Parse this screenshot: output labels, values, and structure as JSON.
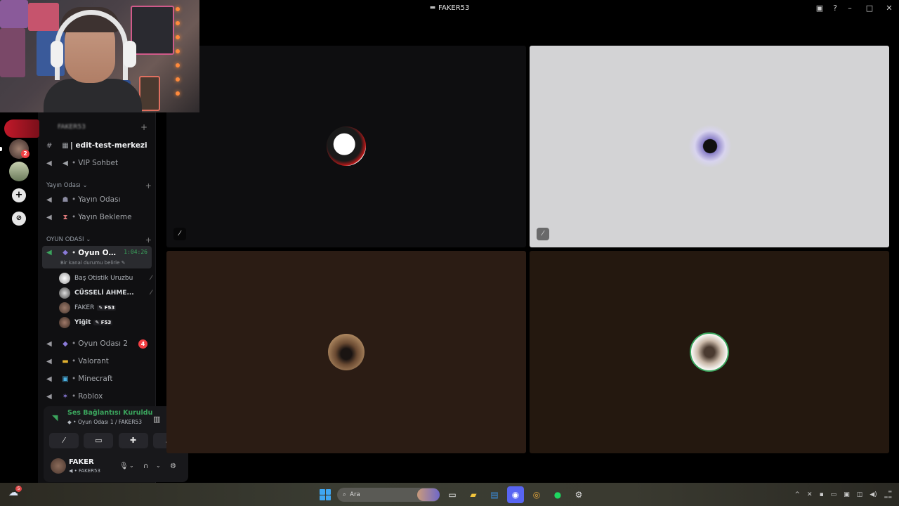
{
  "window": {
    "title": "FAKER53",
    "title_icon": "gamepad-icon",
    "controls": [
      "minimize",
      "maximize",
      "close"
    ]
  },
  "server": {
    "name": "FAKER53",
    "channels_top": [
      {
        "name": "| edit-test-merkezi",
        "type": "text",
        "unread": true
      },
      {
        "name": "VIP Sohbet",
        "type": "voice"
      }
    ],
    "categories": [
      {
        "name": "Yayın Odası",
        "channels": [
          {
            "name": "Yayın Odası",
            "type": "voice"
          },
          {
            "name": "Yayın Bekleme",
            "type": "voice"
          }
        ]
      },
      {
        "name": "OYUN ODASI",
        "channels": [
          {
            "name": "Oyun Od...",
            "type": "voice",
            "active": true,
            "timer": "1:04:26",
            "status_placeholder": "Bir kanal durumu belirle",
            "members": [
              {
                "name": "Baş Otistik Uruzbu",
                "muted": true
              },
              {
                "name": "CÜSSELİ AHME...",
                "muted": true
              },
              {
                "name": "FAKER",
                "tag": "F53"
              },
              {
                "name": "Yiğit",
                "tag": "F53"
              }
            ]
          },
          {
            "name": "Oyun Odası 2",
            "type": "voice",
            "notifications": "4"
          },
          {
            "name": "Valorant",
            "type": "voice"
          },
          {
            "name": "Minecraft",
            "type": "voice"
          },
          {
            "name": "Roblox",
            "type": "voice"
          }
        ]
      }
    ]
  },
  "server_rail": {
    "badge": "2"
  },
  "voice_panel": {
    "status": "Ses Bağlantısı Kuruldu",
    "location": "Oyun Odası 1 / FAKER53",
    "buttons": [
      "camera-off",
      "screen-share",
      "activities",
      "soundboard"
    ]
  },
  "current_user": {
    "name": "FAKER",
    "subtitle": "FAKER53"
  },
  "video_tiles": [
    {
      "avatar": "anime-avatar",
      "background": "#0e0e10",
      "muted": true
    },
    {
      "avatar": "winged-emblem-avatar",
      "background": "#d3d3d5",
      "muted": true
    },
    {
      "avatar": "person-avatar",
      "background": "#2b1c14",
      "muted": false
    },
    {
      "avatar": "skull-avatar",
      "background": "#24180f",
      "muted": false
    }
  ],
  "taskbar": {
    "search_placeholder": "Ara",
    "weather_badge": "5"
  }
}
